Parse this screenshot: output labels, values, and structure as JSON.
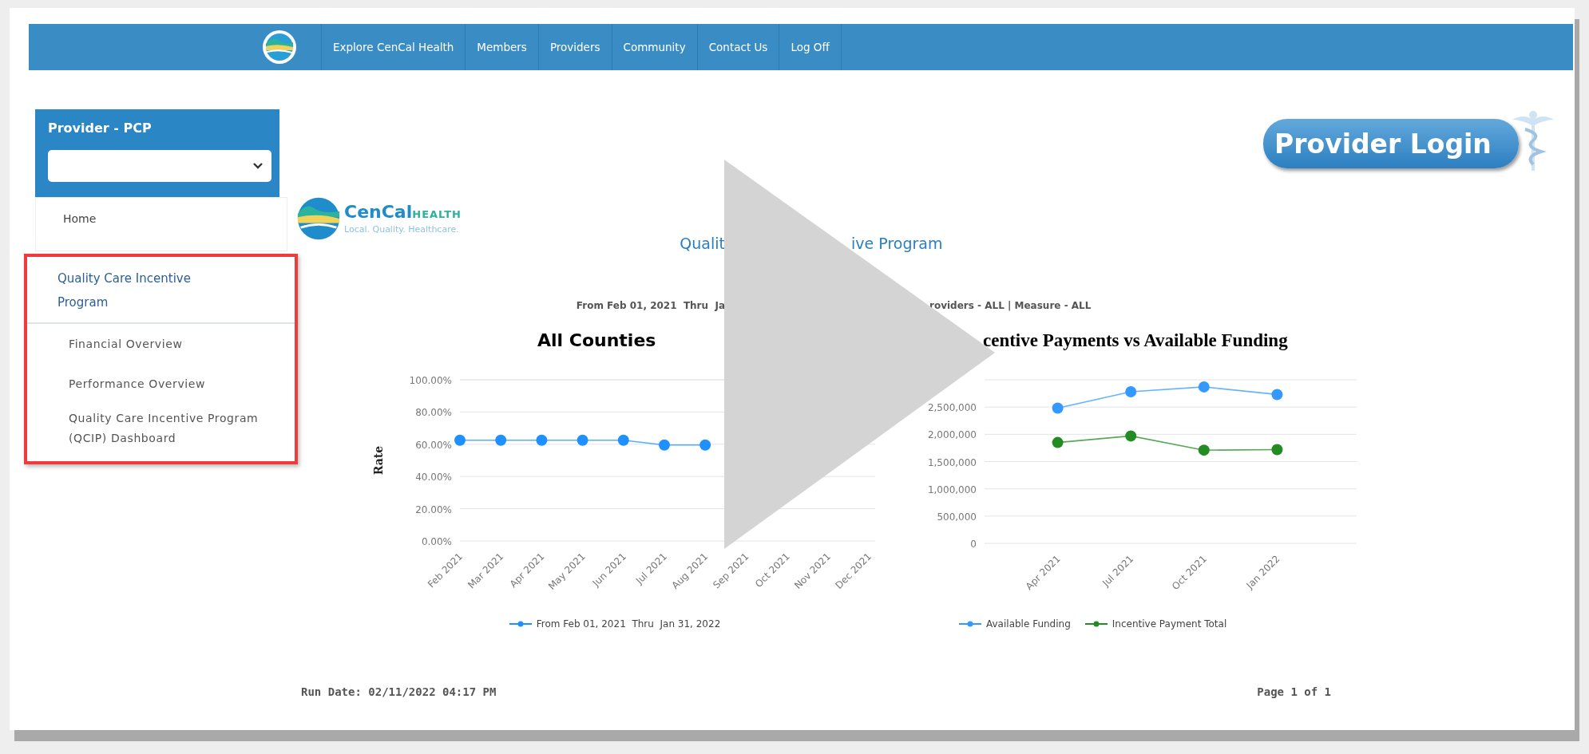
{
  "nav": {
    "items": [
      "Explore CenCal Health",
      "Members",
      "Providers",
      "Community",
      "Contact Us",
      "Log Off"
    ]
  },
  "sidebar": {
    "title": "Provider - PCP",
    "home": "Home",
    "section": {
      "label": "Quality Care Incentive Program",
      "highlighted": true,
      "children": [
        {
          "label": "Financial Overview"
        },
        {
          "label": "Performance Overview"
        },
        {
          "label": "Quality Care Incentive Program (QCIP) Dashboard"
        }
      ]
    }
  },
  "provider_login": "Provider Login",
  "brand": {
    "name": "CenCal",
    "name_suffix": "HEALTH",
    "tagline": "Local. Quality. Healthcare."
  },
  "report": {
    "title_parts": [
      "Qualit",
      "ive Program"
    ],
    "filter_parts": [
      "From Feb 01, 2021  Thru  Ja",
      "roviders - ALL | Measure - ALL"
    ],
    "charts": [
      {
        "chart_data": {
          "type": "line",
          "title": "All Counties",
          "ylabel": "Rate",
          "categories": [
            "Feb 2021",
            "Mar 2021",
            "Apr 2021",
            "May 2021",
            "Jun 2021",
            "Jul 2021",
            "Aug 2021",
            "Sep 2021",
            "Oct 2021",
            "Nov 2021",
            "Dec 2021"
          ],
          "ylim": [
            0,
            100
          ],
          "yticks": [
            {
              "value": 0,
              "label": "0.00%"
            },
            {
              "value": 20,
              "label": "20.00%"
            },
            {
              "value": 40,
              "label": "40.00%"
            },
            {
              "value": 60,
              "label": "60.00%"
            },
            {
              "value": 80,
              "label": "80.00%"
            },
            {
              "value": 100,
              "label": "100.00%"
            }
          ],
          "grid": true,
          "series": [
            {
              "name": "From Feb 01, 2021  Thru  Jan 31, 2022",
              "color": "#1e90ff",
              "marker": true,
              "values": [
                62.5,
                62.5,
                62.5,
                62.5,
                62.5,
                59.5,
                59.5,
                null,
                null,
                null,
                null
              ]
            }
          ]
        }
      },
      {
        "chart_data": {
          "type": "line",
          "title": "centive Payments vs Available Funding",
          "categories": [
            "Apr 2021",
            "Jul 2021",
            "Oct 2021",
            "Jan 2022"
          ],
          "ylim": [
            0,
            3000000
          ],
          "yticks": [
            {
              "value": 0,
              "label": "0"
            },
            {
              "value": 500000,
              "label": "500,000"
            },
            {
              "value": 1000000,
              "label": "1,000,000"
            },
            {
              "value": 1500000,
              "label": "1,500,000"
            },
            {
              "value": 2000000,
              "label": "2,000,000"
            },
            {
              "value": 2500000,
              "label": "2,500,000"
            }
          ],
          "grid": true,
          "series": [
            {
              "name": "Available Funding",
              "color": "#3399ff",
              "marker": true,
              "values": [
                2480000,
                2780000,
                2870000,
                2730000
              ]
            },
            {
              "name": "Incentive Payment Total",
              "color": "#228b22",
              "marker": true,
              "values": [
                1850000,
                1970000,
                1710000,
                1720000
              ]
            }
          ]
        }
      }
    ],
    "run_date": "Run Date: 02/11/2022 04:17 PM",
    "page": "Page 1 of 1"
  }
}
